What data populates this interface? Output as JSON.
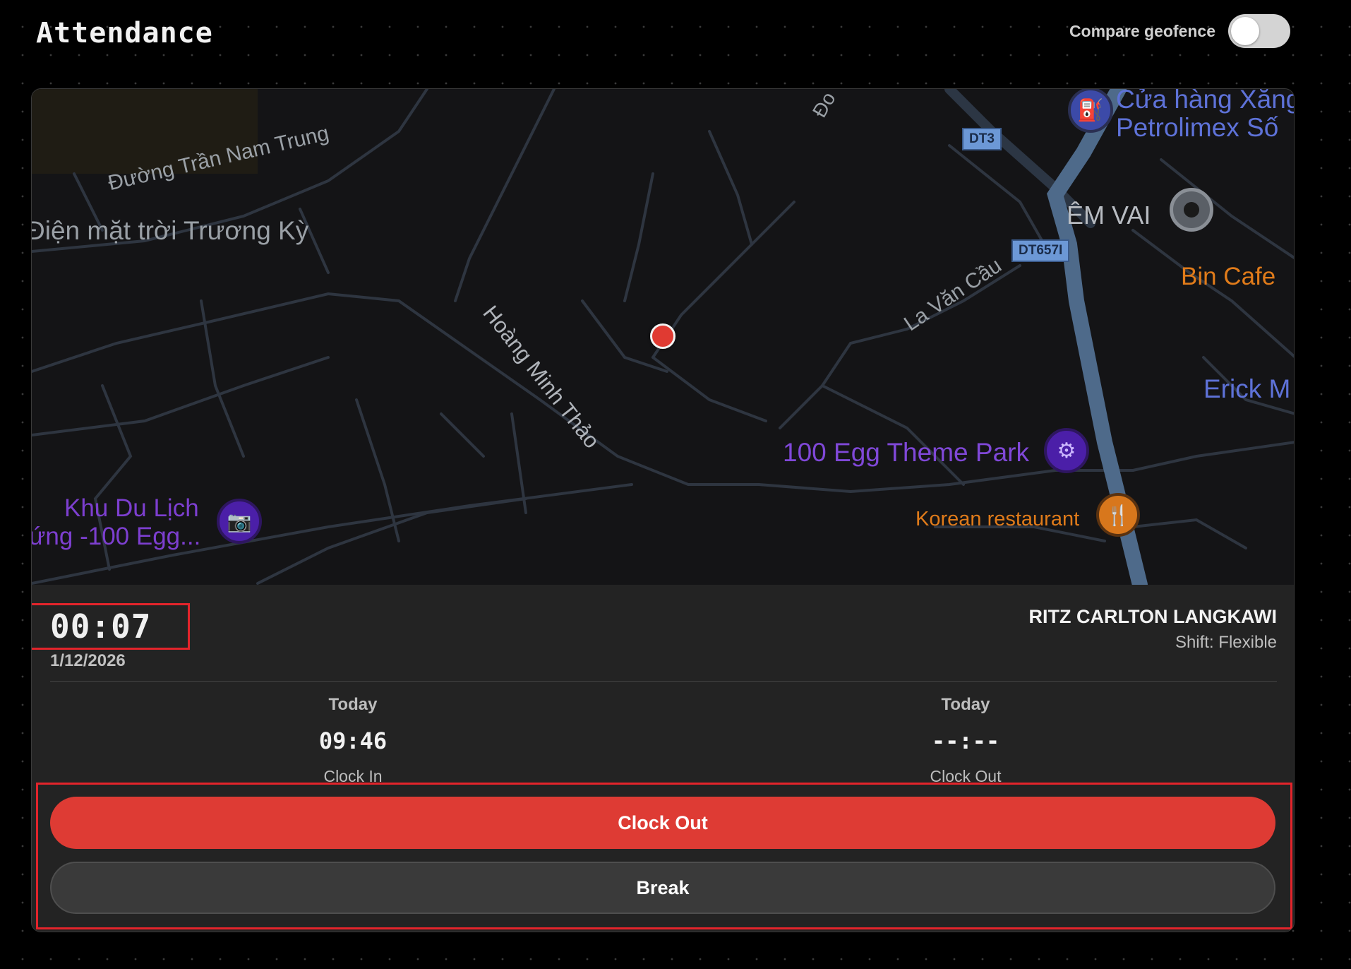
{
  "header": {
    "title": "Attendance",
    "geofence_label": "Compare geofence",
    "geofence_on": false
  },
  "map": {
    "labels": {
      "street_tran_nam_trung": "Đường Trần Nam Trung",
      "solar_truong_ky": "Điện mặt trời Trương Kỳ",
      "street_hoang_minh_thao": "Hoàng Minh Thảo",
      "street_la_van_cau": "La Văn Cầu",
      "road_dt3": "DT3",
      "road_dt657i": "DT657I",
      "gas_station_line1": "Cửa hàng Xăng",
      "gas_station_line2": "Petrolimex Số",
      "em_vai": "ÊM VAI",
      "bin_cafe": "Bin Cafe",
      "erick": "Erick M",
      "egg_park": "100 Egg Theme Park",
      "korean_restaurant": "Korean restaurant",
      "khu_du_lich_line1": "Khu Du Lịch",
      "khu_du_lich_line2": "ứng -100 Egg...",
      "road_do": "Đo"
    },
    "colors": {
      "background": "#141416",
      "road": "#2e3540",
      "highway": "#4e6a8a",
      "purple_poi": "#7b3fd4",
      "orange_poi": "#e07b1a",
      "blue_poi": "#5568c8",
      "current_location": "#e03a32"
    }
  },
  "timer": {
    "elapsed": "00:07",
    "date": "1/12/2026"
  },
  "location": {
    "name": "RITZ CARLTON LANGKAWI",
    "shift": "Shift: Flexible"
  },
  "clock_in": {
    "day": "Today",
    "time": "09:46",
    "label": "Clock In"
  },
  "clock_out": {
    "day": "Today",
    "time": "--:--",
    "label": "Clock Out"
  },
  "actions": {
    "clock_out_label": "Clock Out",
    "break_label": "Break",
    "primary_color": "#de3b34"
  }
}
